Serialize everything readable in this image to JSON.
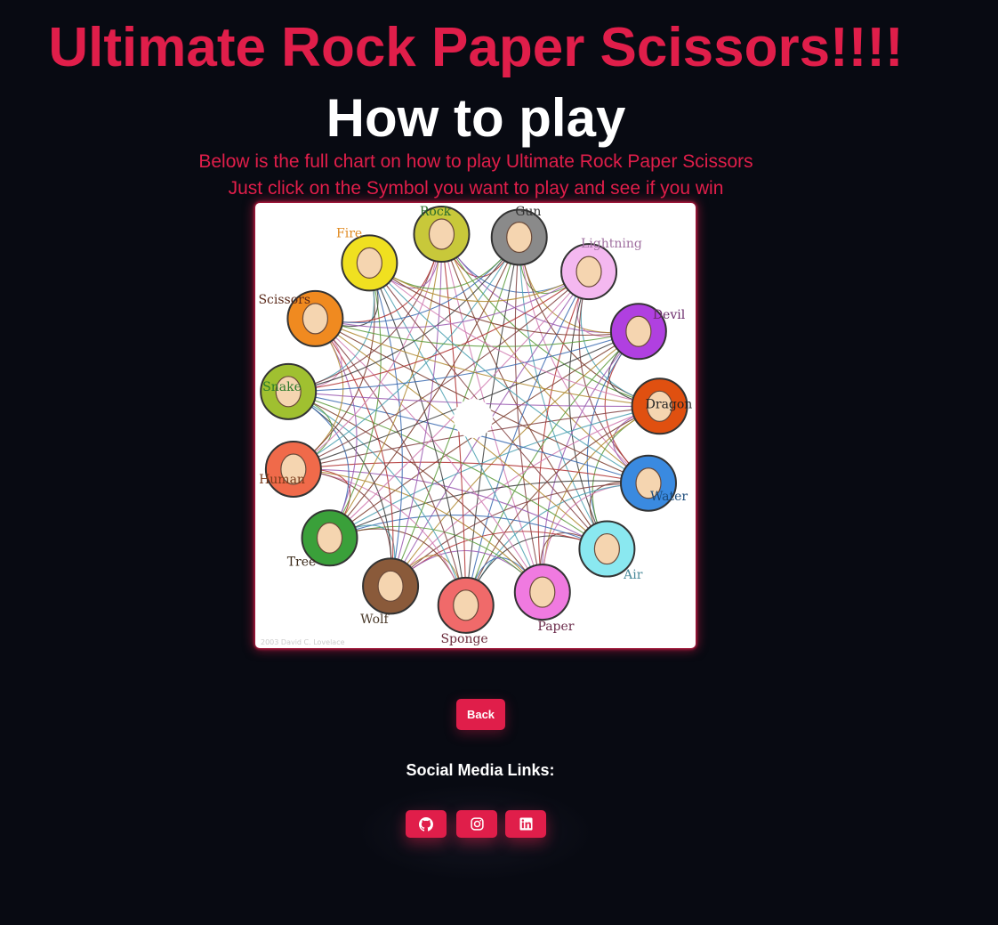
{
  "header": {
    "title": "Ultimate Rock Paper Scissors!!!!",
    "subtitle": "How to play",
    "description_line1": "Below is the full chart on how to play Ultimate Rock Paper Scissors",
    "description_line2": "Just click on the Symbol you want to play and see if you win"
  },
  "chart": {
    "symbols": [
      {
        "name": "Rock",
        "color": "#c8c83a",
        "label_color": "#2a6a2a"
      },
      {
        "name": "Gun",
        "color": "#8a8a8a",
        "label_color": "#333333"
      },
      {
        "name": "Lightning",
        "color": "#f4b8f0",
        "label_color": "#a070a0"
      },
      {
        "name": "Devil",
        "color": "#b040e0",
        "label_color": "#6a2a6a"
      },
      {
        "name": "Dragon",
        "color": "#e05010",
        "label_color": "#222222"
      },
      {
        "name": "Water",
        "color": "#3a8ae0",
        "label_color": "#1a4a7a"
      },
      {
        "name": "Air",
        "color": "#8ae8f0",
        "label_color": "#4a8a9a"
      },
      {
        "name": "Paper",
        "color": "#f07ae0",
        "label_color": "#6a2a4a"
      },
      {
        "name": "Sponge",
        "color": "#f06a6a",
        "label_color": "#6a2a3a"
      },
      {
        "name": "Wolf",
        "color": "#8a5a3a",
        "label_color": "#4a3a2a"
      },
      {
        "name": "Tree",
        "color": "#3aa03a",
        "label_color": "#3a2a1a"
      },
      {
        "name": "Human",
        "color": "#f06a4a",
        "label_color": "#7a3a1a"
      },
      {
        "name": "Snake",
        "color": "#a0c030",
        "label_color": "#2a7a2a"
      },
      {
        "name": "Scissors",
        "color": "#f08a20",
        "label_color": "#5a2a1a"
      },
      {
        "name": "Fire",
        "color": "#f0e020",
        "label_color": "#e08a20"
      }
    ],
    "hand_color": "#f5d5b0",
    "copyright": "2003 David C. Lovelace"
  },
  "actions": {
    "back_label": "Back"
  },
  "social": {
    "label": "Social Media Links:",
    "links": [
      {
        "name": "github",
        "icon": "github-icon"
      },
      {
        "name": "instagram",
        "icon": "instagram-icon"
      },
      {
        "name": "linkedin",
        "icon": "linkedin-icon"
      }
    ]
  },
  "colors": {
    "background": "#080a12",
    "accent": "#e01e4a",
    "text": "#ffffff"
  }
}
